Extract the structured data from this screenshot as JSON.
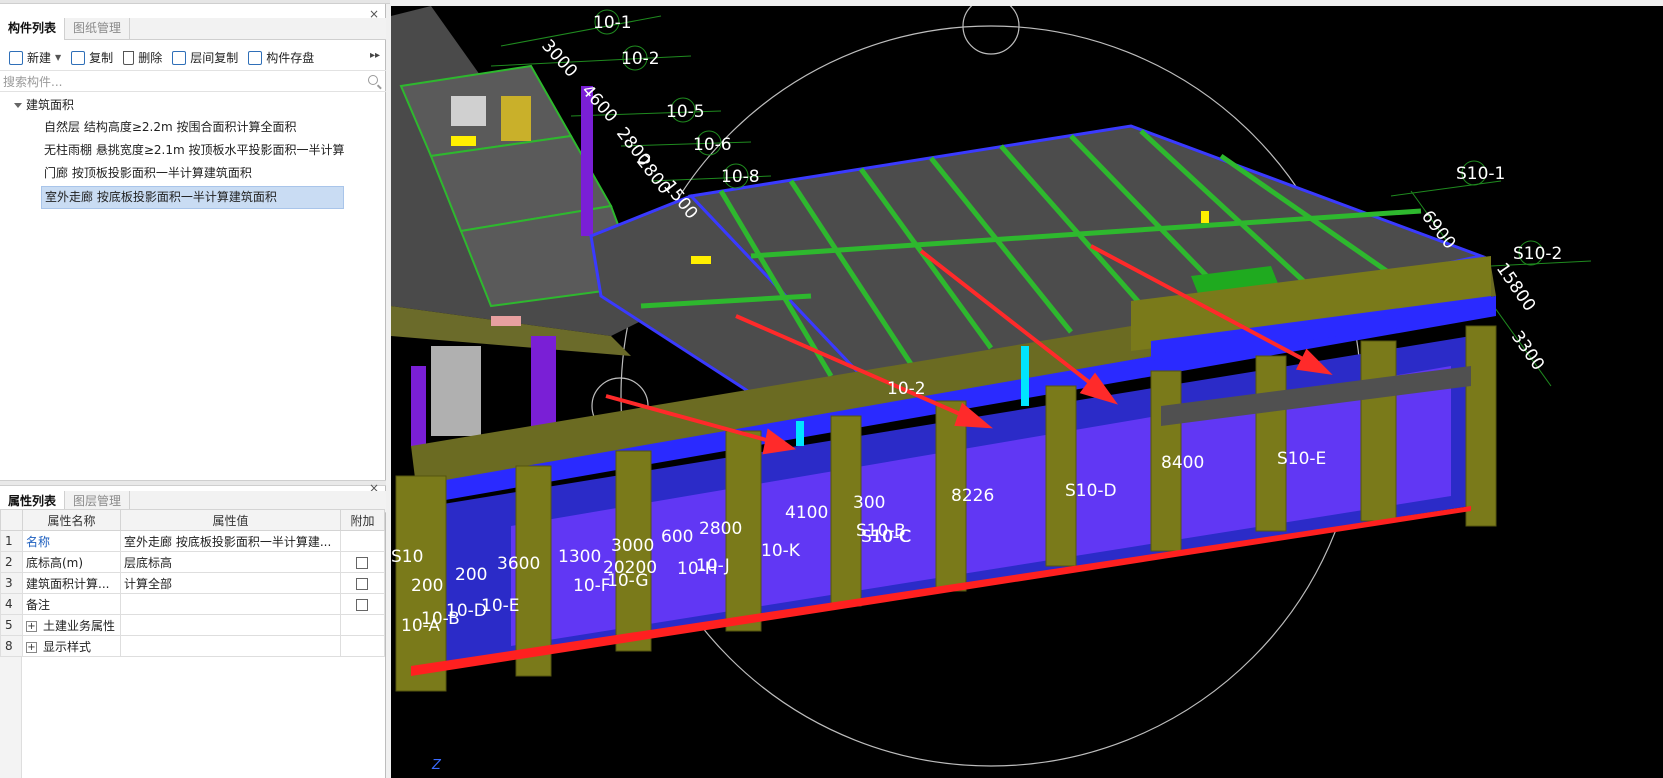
{
  "component_panel": {
    "tabs": [
      "构件列表",
      "图纸管理"
    ],
    "toolbar": {
      "new": "新建",
      "copy": "复制",
      "delete": "删除",
      "floor_copy": "层间复制",
      "save": "构件存盘"
    },
    "search_placeholder": "搜索构件...",
    "tree_root": "建筑面积",
    "tree_items": [
      "自然层 结构高度≥2.2m 按围合面积计算全面积",
      "无柱雨棚 悬挑宽度≥2.1m 按顶板水平投影面积一半计算",
      "门廊 按顶板投影面积一半计算建筑面积",
      "室外走廊 按底板投影面积一半计算建筑面积"
    ]
  },
  "property_panel": {
    "tabs": [
      "属性列表",
      "图层管理"
    ],
    "headers": [
      "属性名称",
      "属性值",
      "附加"
    ],
    "rows": [
      {
        "num": "1",
        "name": "名称",
        "value": "室外走廊 按底板投影面积一半计算建..."
      },
      {
        "num": "2",
        "name": "底标高(m)",
        "value": "层底标高"
      },
      {
        "num": "3",
        "name": "建筑面积计算...",
        "value": "计算全部"
      },
      {
        "num": "4",
        "name": "备注",
        "value": ""
      },
      {
        "num": "5",
        "name": "土建业务属性",
        "value": ""
      },
      {
        "num": "8",
        "name": "显示样式",
        "value": ""
      }
    ]
  },
  "viewport": {
    "axis_labels": [
      "10-1",
      "10-2",
      "10-5",
      "10-6",
      "10-8",
      "S10-1",
      "S10-2",
      "S10-D",
      "S10-E",
      "10-F",
      "10-G",
      "10-K",
      "10-J",
      "10-E",
      "10-D",
      "10-A",
      "10-B",
      "10-C",
      "10-H",
      "S10",
      "S10-C",
      "S10-B",
      "10-2"
    ],
    "dimensions": [
      "3000",
      "4600",
      "2800",
      "2800",
      "1500",
      "6900",
      "15800",
      "3300",
      "8400",
      "8226",
      "4100",
      "300",
      "2800",
      "600",
      "3000",
      "20200",
      "1300",
      "3600",
      "200",
      "200"
    ],
    "axis_indicator": "Z"
  },
  "colors": {
    "selection": "#c9dcf3",
    "viewport_bg": "#000000",
    "slab": "#555555",
    "beam": "#2eb82e",
    "column": "#808000",
    "wall": "#8a2be2",
    "arrow": "#ff2a2a"
  }
}
